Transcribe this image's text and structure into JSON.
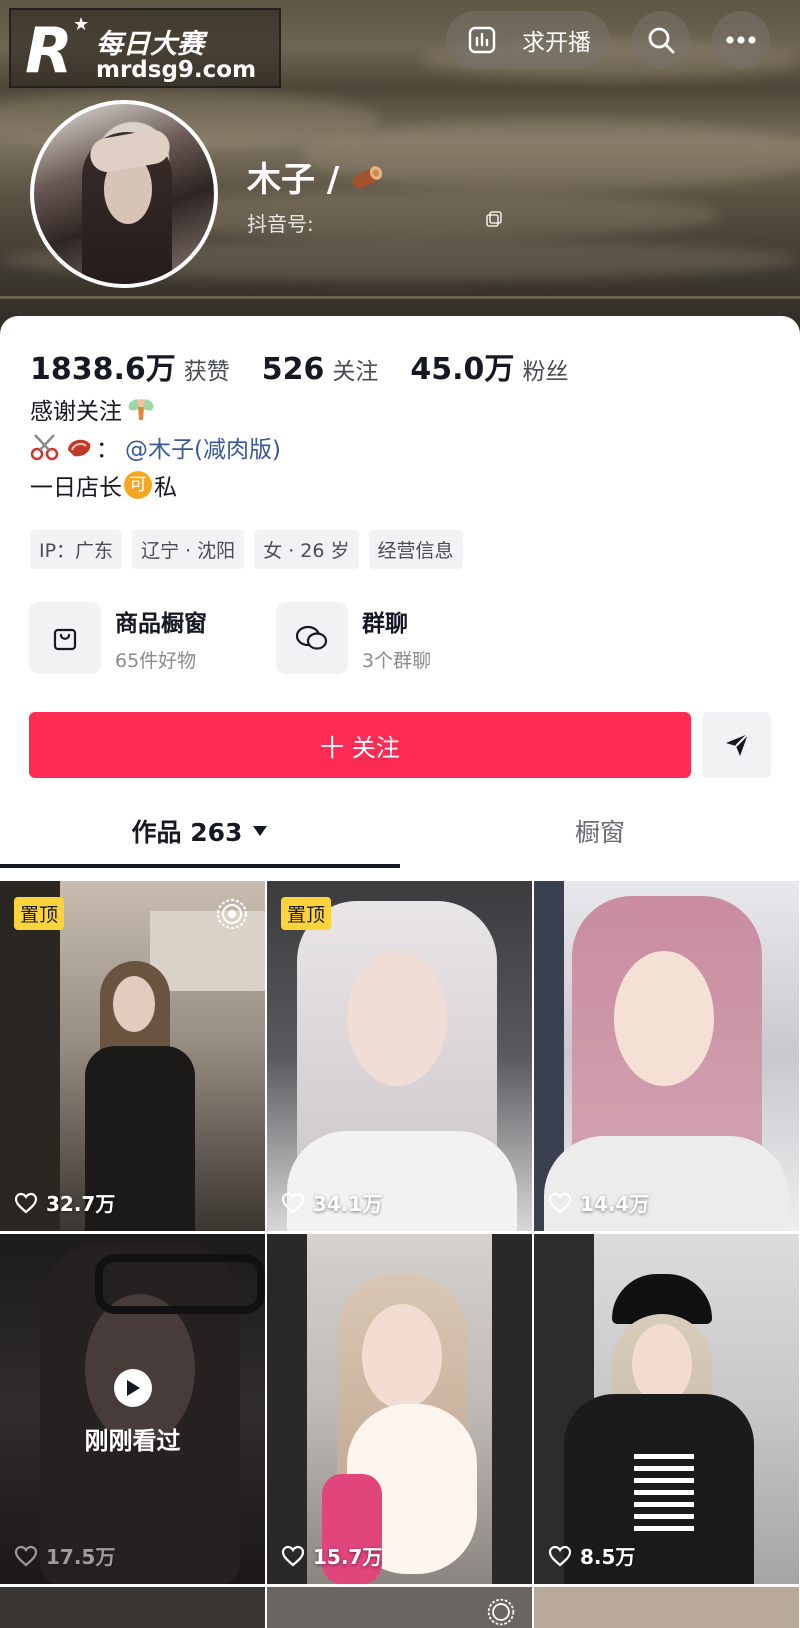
{
  "watermark": {
    "cn": "每日大赛",
    "url": "mrdsg9.com"
  },
  "header": {
    "trending_label": "求开播",
    "nickname": "木子 /",
    "douyin_id_label": "抖音号:"
  },
  "stats": [
    {
      "value": "1838.6万",
      "label": "获赞"
    },
    {
      "value": "526",
      "label": "关注"
    },
    {
      "value": "45.0万",
      "label": "粉丝"
    }
  ],
  "bio": {
    "line1": "感谢关注",
    "line2_link": "@木子(减肉版)",
    "line3_a": "一日店长",
    "line3_coin": "可",
    "line3_b": "私"
  },
  "tags": [
    "IP：广东",
    "辽宁 · 沈阳",
    "女 · 26 岁",
    "经营信息"
  ],
  "entries": {
    "shop": {
      "title": "商品橱窗",
      "sub": "65件好物"
    },
    "group": {
      "title": "群聊",
      "sub": "3个群聊"
    }
  },
  "follow_label": "十 关注",
  "tabs": {
    "works": "作品 263",
    "window": "橱窗"
  },
  "videos": [
    {
      "pinned": true,
      "pin_label": "置顶",
      "likes": "32.7万"
    },
    {
      "pinned": true,
      "pin_label": "置顶",
      "likes": "34.1万"
    },
    {
      "pinned": false,
      "likes": "14.4万"
    },
    {
      "pinned": false,
      "likes": "17.5万",
      "watched_label": "刚刚看过"
    },
    {
      "pinned": false,
      "likes": "15.7万"
    },
    {
      "pinned": false,
      "likes": "8.5万"
    }
  ],
  "colors": {
    "accent": "#fe2c55",
    "pin": "#fcd33b",
    "link": "#3b5998"
  }
}
